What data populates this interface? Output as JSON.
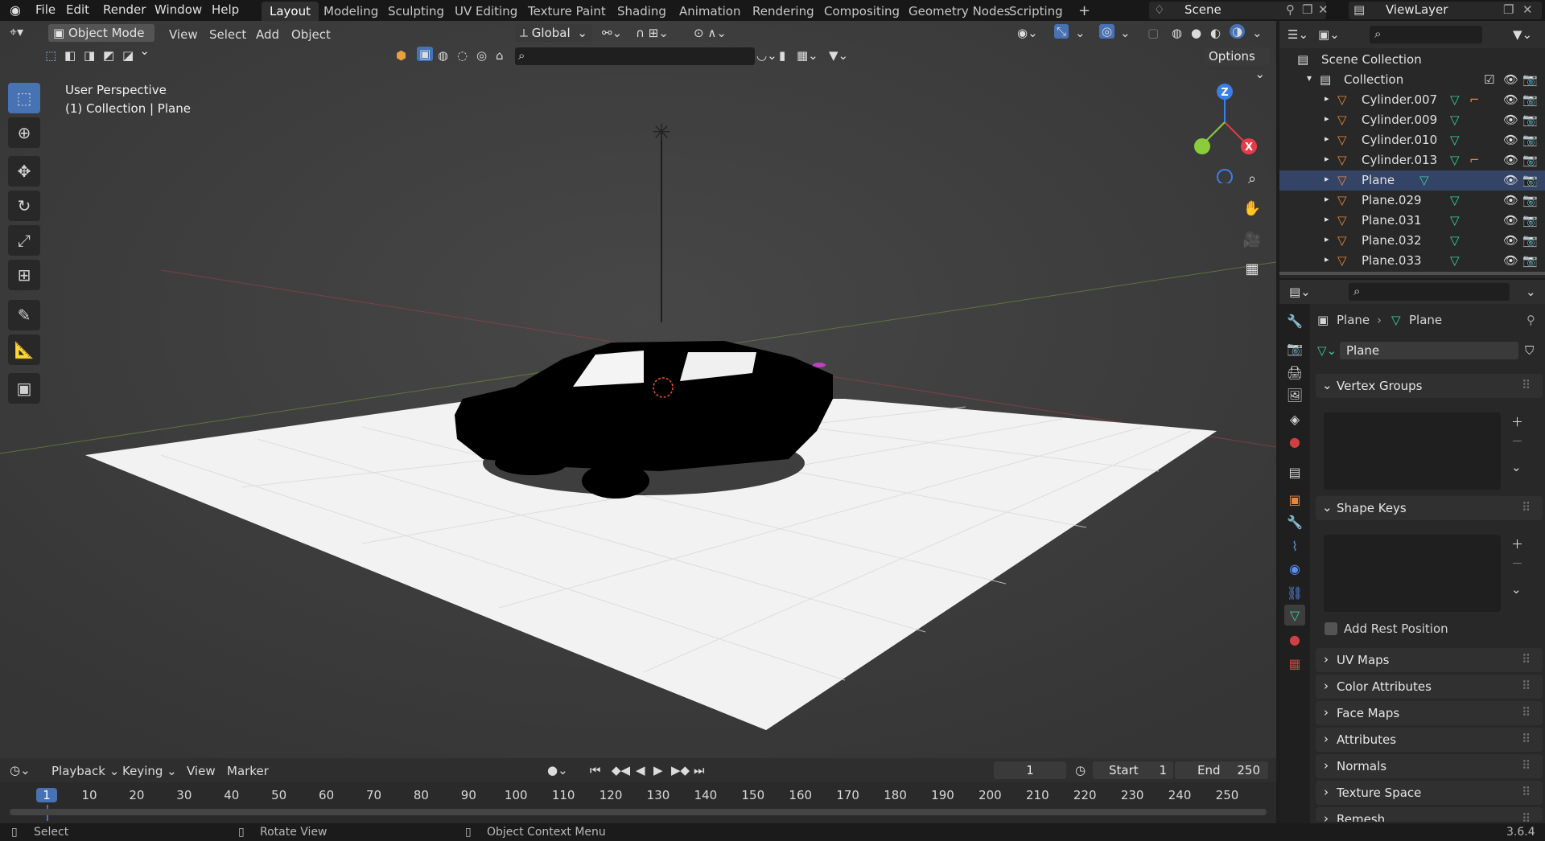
{
  "topbar": {
    "menus": [
      "File",
      "Edit",
      "Render",
      "Window",
      "Help"
    ],
    "workspaces": [
      "Layout",
      "Modeling",
      "Sculpting",
      "UV Editing",
      "Texture Paint",
      "Shading",
      "Animation",
      "Rendering",
      "Compositing",
      "Geometry Nodes",
      "Scripting"
    ],
    "active_workspace": "Layout",
    "add_tab": "+",
    "scene": "Scene",
    "view_layer": "ViewLayer"
  },
  "viewport": {
    "mode": "Object Mode",
    "menus": [
      "View",
      "Select",
      "Add",
      "Object"
    ],
    "transform_orientation": "Global",
    "options_label": "Options",
    "overlay_title": "User Perspective",
    "overlay_subtitle": "(1) Collection | Plane",
    "gizmo": {
      "z": "Z",
      "x": "X"
    }
  },
  "outliner": {
    "root": "Scene Collection",
    "collection": "Collection",
    "items": [
      "Cylinder.007",
      "Cylinder.009",
      "Cylinder.010",
      "Cylinder.013",
      "Plane",
      "Plane.029",
      "Plane.031",
      "Plane.032",
      "Plane.033"
    ],
    "selected_item": "Plane"
  },
  "properties": {
    "breadcrumb_object": "Plane",
    "breadcrumb_data": "Plane",
    "mesh_name": "Plane",
    "panels": {
      "vertex_groups": "Vertex Groups",
      "shape_keys": "Shape Keys",
      "add_rest_position": "Add Rest Position",
      "uv_maps": "UV Maps",
      "color_attributes": "Color Attributes",
      "face_maps": "Face Maps",
      "attributes": "Attributes",
      "normals": "Normals",
      "texture_space": "Texture Space",
      "remesh": "Remesh"
    }
  },
  "timeline": {
    "menus": [
      "Playback",
      "Keying",
      "View",
      "Marker"
    ],
    "current_frame": "1",
    "start_label": "Start",
    "start_value": "1",
    "end_label": "End",
    "end_value": "250",
    "ruler": [
      "1",
      "10",
      "20",
      "30",
      "40",
      "50",
      "60",
      "70",
      "80",
      "90",
      "100",
      "110",
      "120",
      "130",
      "140",
      "150",
      "160",
      "170",
      "180",
      "190",
      "200",
      "210",
      "220",
      "230",
      "240",
      "250"
    ]
  },
  "status": {
    "select": "Select",
    "rotate": "Rotate View",
    "context": "Object Context Menu",
    "version": "3.6.4"
  },
  "colors": {
    "accent": "#4772b3",
    "mesh_icon": "#e8863a",
    "data_icon": "#3ecf9a",
    "x_axis": "#e83a4a",
    "y_axis": "#8acc3a",
    "z_axis": "#3a7ee8"
  }
}
